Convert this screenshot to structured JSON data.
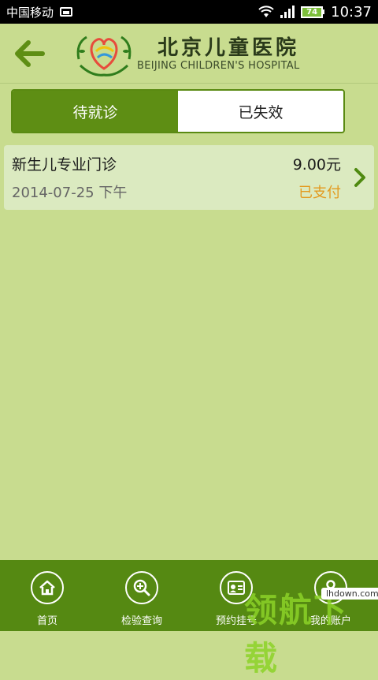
{
  "status_bar": {
    "carrier": "中国移动",
    "battery_level": "74",
    "time": "10:37"
  },
  "header": {
    "hospital_name_cn": "北京儿童医院",
    "hospital_name_en": "BEIJING CHILDREN'S HOSPITAL"
  },
  "tabs": [
    {
      "label": "待就诊",
      "active": true
    },
    {
      "label": "已失效",
      "active": false
    }
  ],
  "records": [
    {
      "title": "新生儿专业门诊",
      "price": "9.00元",
      "date": "2014-07-25 下午",
      "status": "已支付"
    }
  ],
  "bottom_nav": [
    {
      "label": "首页",
      "icon": "home-icon"
    },
    {
      "label": "检验查询",
      "icon": "zoom-in-icon"
    },
    {
      "label": "预约挂号",
      "icon": "card-icon"
    },
    {
      "label": "我的账户",
      "icon": "user-icon"
    }
  ],
  "watermark": {
    "url": "lhdown.com",
    "text": "领航下载"
  },
  "colors": {
    "background": "#c8dc8f",
    "accent": "#5e8e14",
    "nav_bar": "#558912",
    "paid_status": "#e39a1e"
  }
}
